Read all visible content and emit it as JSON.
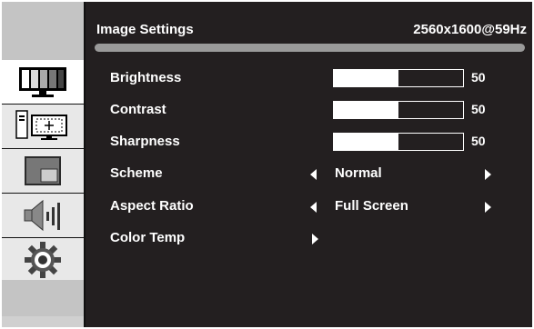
{
  "header": {
    "title": "Image Settings",
    "resolution": "2560x1600@59Hz"
  },
  "sidebar": {
    "icons": [
      "picture-icon",
      "computer-input-icon",
      "pip-window-icon",
      "speaker-icon",
      "gear-icon"
    ],
    "active": "picture-icon"
  },
  "settings": {
    "brightness": {
      "label": "Brightness",
      "value": "50",
      "level": 0.5
    },
    "contrast": {
      "label": "Contrast",
      "value": "50",
      "level": 0.5
    },
    "sharpness": {
      "label": "Sharpness",
      "value": "50",
      "level": 0.5
    },
    "scheme": {
      "label": "Scheme",
      "value": "Normal"
    },
    "aspect_ratio": {
      "label": "Aspect Ratio",
      "value": "Full Screen"
    },
    "color_temp": {
      "label": "Color Temp"
    }
  },
  "colors": {
    "background": "#231f20",
    "text": "#ffffff",
    "sidebar": "#d0d0d0",
    "header_bar": "#9a9a9a"
  }
}
